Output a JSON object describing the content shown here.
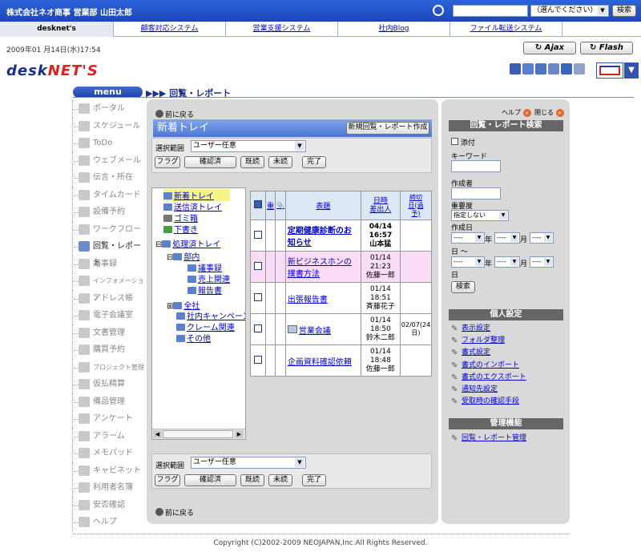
{
  "header": {
    "company": "株式会社ネオ商事 営業部 山田太郎",
    "search_select": "（選んでください）",
    "search_button": "検索"
  },
  "tabs": [
    "desknet's",
    "顧客対応システム",
    "営業支援システム",
    "社内Blog",
    "ファイル転送システム"
  ],
  "date": "2009年01 月14日(水)17:54",
  "toolbar": {
    "ajax": "Ajax",
    "flash": "Flash"
  },
  "logo": {
    "a": "desk",
    "b": "NET'S"
  },
  "menu": {
    "title": "menu",
    "items": [
      "ポータル",
      "スケジュール",
      "ToDo",
      "ウェブメール",
      "伝言・所在",
      "タイムカード",
      "設備予約",
      "ワークフロー",
      "回覧・レポート",
      "議事録",
      "インフォメーション",
      "アドレス帳",
      "電子会議室",
      "文書管理",
      "購買予約",
      "プロジェクト管理",
      "仮払精算",
      "備品管理",
      "アンケート",
      "アラーム",
      "メモパッド",
      "キャビネット",
      "利用者名簿",
      "安否確認",
      "ヘルプ"
    ]
  },
  "breadcrumb": "▶▶▶ 回覧・レポート",
  "main": {
    "back": "前に戻る",
    "tray_title": "新着トレイ",
    "new_button": "新規回覧・レポート作成",
    "range_label": "選択範囲",
    "range_value": "ユーザー任意",
    "buttons": [
      "フラグ",
      "確認済",
      "既読",
      "未読",
      "完了"
    ]
  },
  "tree": [
    {
      "label": "新着トレイ"
    },
    {
      "label": "送信済トレイ"
    },
    {
      "label": "ゴミ箱"
    },
    {
      "label": "下書き"
    },
    {
      "label": "処理済トレイ"
    },
    {
      "label": "部内"
    },
    {
      "label": "議事録"
    },
    {
      "label": "売上関連"
    },
    {
      "label": "報告書"
    },
    {
      "label": "全社"
    },
    {
      "label": "社内キャンペーン"
    },
    {
      "label": "クレーム関連"
    },
    {
      "label": "その他"
    }
  ],
  "table": {
    "headers": {
      "flag": "重",
      "attach": "📎",
      "title": "表題",
      "dt1": "日時",
      "dt2": "差出人",
      "due1": "締切",
      "due2": "日(過",
      "due3": "予)"
    },
    "rows": [
      {
        "title": "定期健康診断のお知らせ",
        "date": "04/14",
        "time": "16:57",
        "sender": "山本猛",
        "due": "",
        "bold": true
      },
      {
        "title": "新ビジネスホンの撲書方法",
        "date": "01/14",
        "time": "21:23",
        "sender": "佐藤一郎",
        "due": "",
        "pink": true
      },
      {
        "title": "出張報告書",
        "date": "01/14",
        "time": "18:51",
        "sender": "斉藤花子",
        "due": ""
      },
      {
        "title": "営業会議",
        "date": "01/14",
        "time": "18:50",
        "sender": "鈴木二郎",
        "due": "02/07(24日)"
      },
      {
        "title": "企画資料確認依頼",
        "date": "01/14",
        "time": "18:48",
        "sender": "佐藤一郎",
        "due": ""
      }
    ]
  },
  "right": {
    "help": "ヘルプ",
    "close": "閉じる",
    "search_title": "回覧・レポート検索",
    "attach": "添付",
    "keyword": "キーワード",
    "creator": "作成者",
    "importance": "重要度",
    "importance_value": "指定しない",
    "created": "作成日",
    "dash": "----",
    "year": "年",
    "month": "月",
    "day": "日",
    "range": "日 〜",
    "search": "検索",
    "personal_title": "個人設定",
    "personal": [
      "表示設定",
      "フォルダ整理",
      "書式設定",
      "書式のインポート",
      "書式のエクスポート",
      "通知先設定",
      "受取時の確認手段"
    ],
    "admin_title": "管理機能",
    "admin": [
      "回覧・レポート管理"
    ]
  },
  "footer": "Copyright (C)2002-2009 NEOJAPAN,Inc.All Rights Reserved."
}
